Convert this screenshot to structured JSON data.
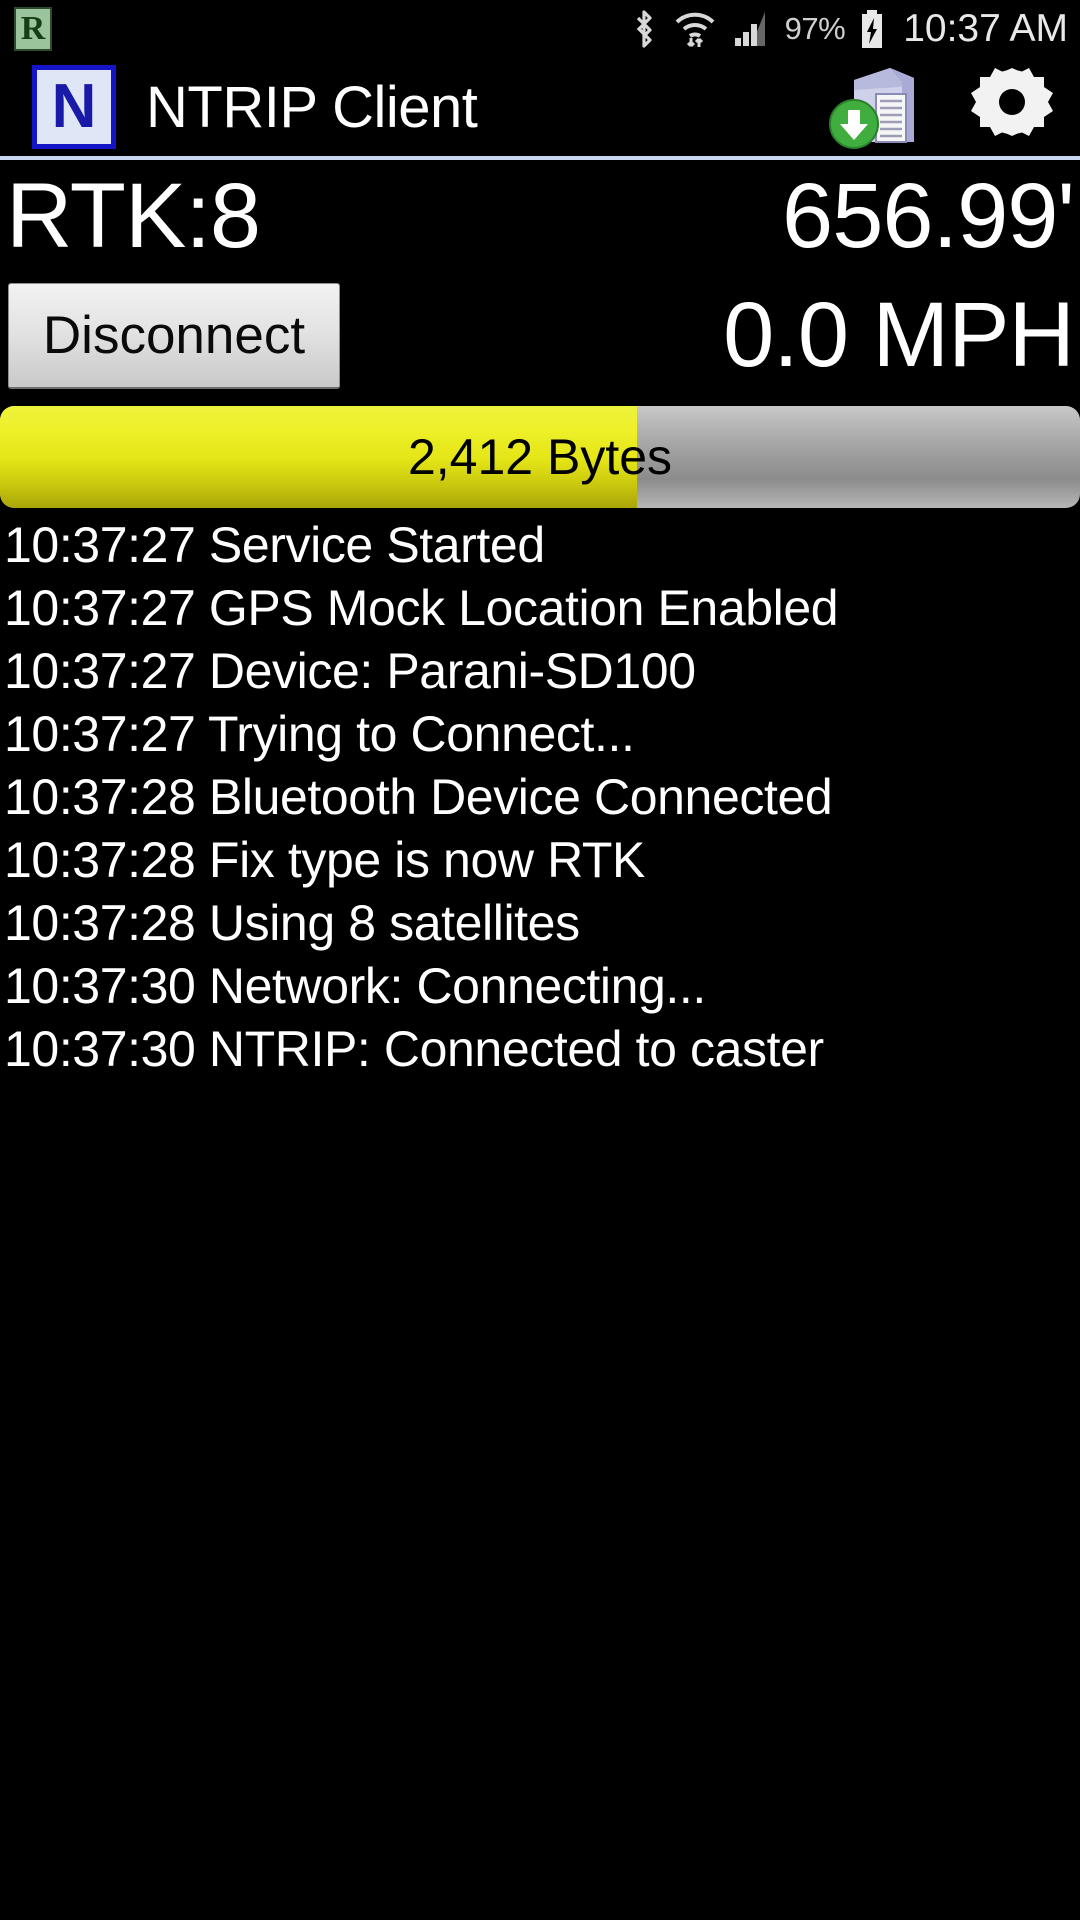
{
  "statusbar": {
    "notification_badge": "R",
    "icons": [
      "bluetooth-icon",
      "wifi-icon",
      "cellular-signal-icon",
      "battery-charging-icon"
    ],
    "battery_percent": "97%",
    "clock": "10:37 AM"
  },
  "appbar": {
    "logo_letter": "N",
    "title": "NTRIP Client",
    "actions": [
      {
        "name": "server-download-icon",
        "label": "Caster"
      },
      {
        "name": "gear-icon",
        "label": "Settings"
      }
    ]
  },
  "status": {
    "fix_status": "RTK:8",
    "altitude": "656.99'",
    "speed": "0.0 MPH",
    "connect_button": "Disconnect"
  },
  "bytes_bar": {
    "label": "2,412 Bytes",
    "fill_percent": 59,
    "fill_color": "#e4e617",
    "track_color": "#9a9a9a"
  },
  "log": {
    "lines": [
      "10:37:27 Service Started",
      "10:37:27 GPS Mock Location Enabled",
      "10:37:27 Device: Parani-SD100",
      "10:37:27 Trying to Connect...",
      "10:37:28 Bluetooth Device Connected",
      "10:37:28 Fix type is now RTK",
      "10:37:28 Using 8 satellites",
      "10:37:30 Network: Connecting...",
      "10:37:30 NTRIP: Connected to caster"
    ]
  },
  "colors": {
    "background": "#000000",
    "text": "#ffffff",
    "divider": "#c8d8f0",
    "accent_yellow": "#e4e617",
    "logo_blue": "#1414c8"
  }
}
